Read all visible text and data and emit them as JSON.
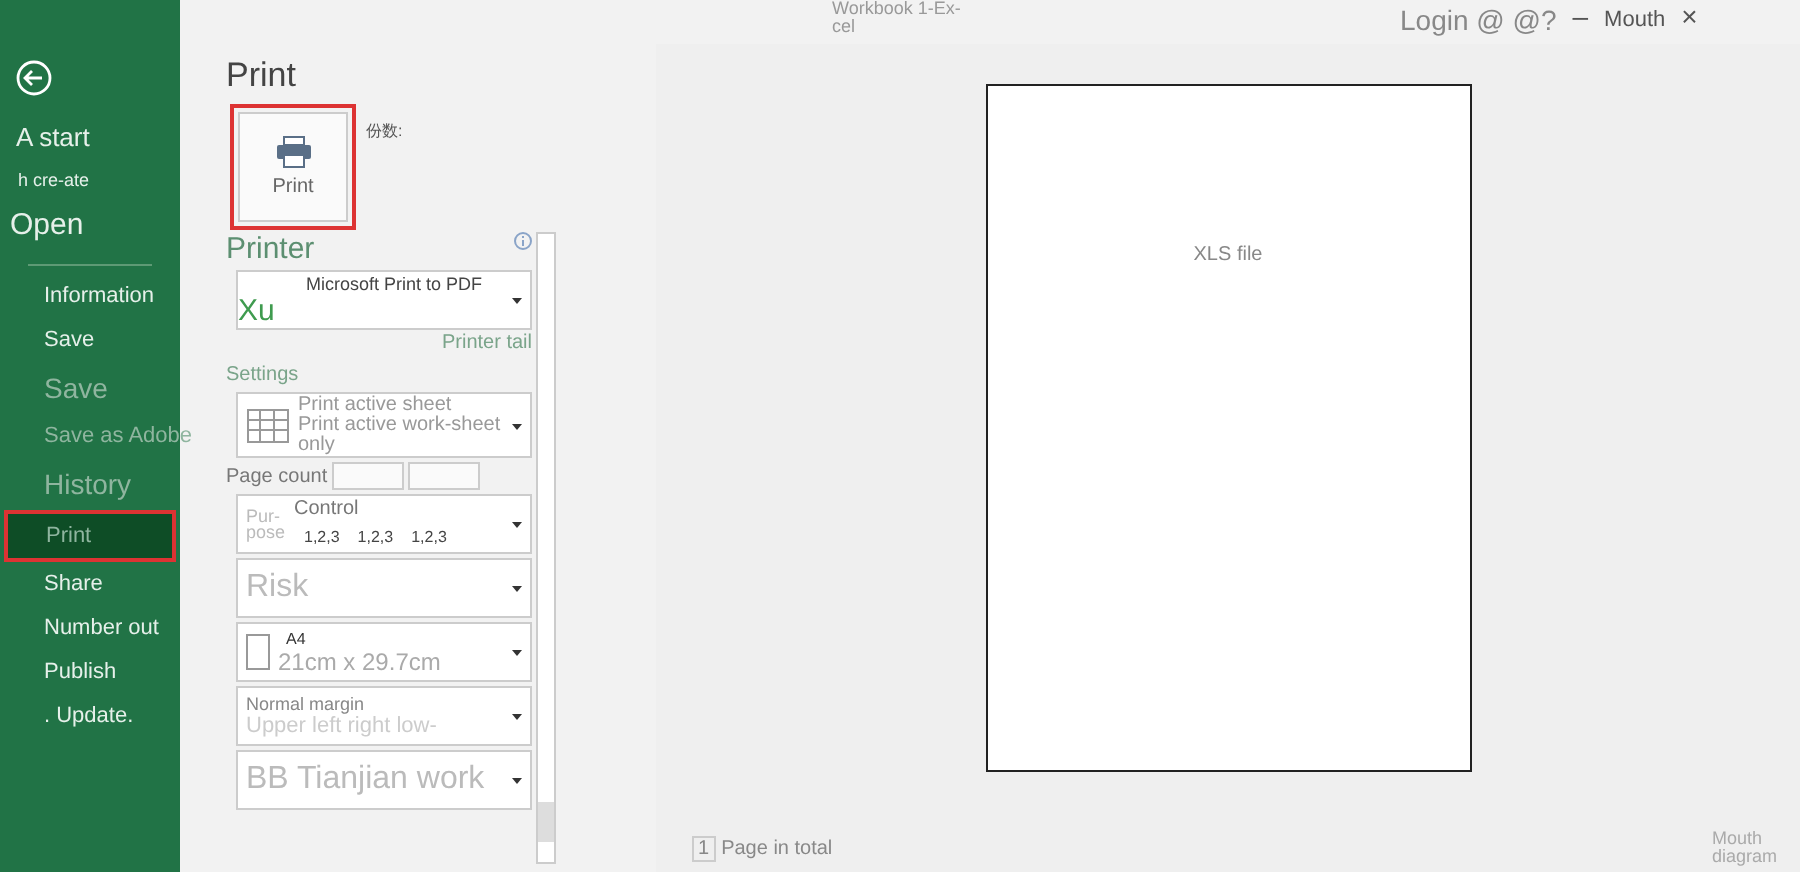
{
  "window": {
    "title": "Workbook 1-Ex-cel",
    "login": "Login @ @?",
    "minimize": "–",
    "account": "Mouth",
    "close": "×"
  },
  "sidebar": {
    "items": [
      {
        "label": "A start",
        "kind": "normal",
        "disabled": false,
        "selected": false
      },
      {
        "label": "h cre-ate",
        "kind": "small",
        "disabled": false,
        "selected": false
      },
      {
        "label": "Open",
        "kind": "large",
        "disabled": false,
        "selected": false
      },
      {
        "label": "Information",
        "kind": "indent",
        "disabled": false,
        "selected": false
      },
      {
        "label": "Save",
        "kind": "indent",
        "disabled": false,
        "selected": false
      },
      {
        "label": "Save",
        "kind": "big",
        "disabled": true,
        "selected": false
      },
      {
        "label": "Save as Adobe",
        "kind": "indent",
        "disabled": true,
        "selected": false
      },
      {
        "label": "History",
        "kind": "big",
        "disabled": true,
        "selected": false
      },
      {
        "label": "Print",
        "kind": "indent",
        "disabled": true,
        "selected": true
      },
      {
        "label": "Share",
        "kind": "indent",
        "disabled": false,
        "selected": false
      },
      {
        "label": "Number out",
        "kind": "indent",
        "disabled": false,
        "selected": false
      },
      {
        "label": "Publish",
        "kind": "indent",
        "disabled": false,
        "selected": false
      },
      {
        "label": ". Update.",
        "kind": "indent",
        "disabled": false,
        "selected": false
      }
    ]
  },
  "print": {
    "heading": "Print",
    "button": "Print",
    "copies_label": "份数:",
    "printer_heading": "Printer",
    "printer": "Microsoft Print to PDF",
    "printer_overlay": "Xu",
    "printer_link": "Printer tail",
    "settings_heading": "Settings",
    "page_count_label": "Page count",
    "dropdowns": [
      {
        "kind": "sheet",
        "lines": [
          "Print active sheet",
          "Print active work-sheet only"
        ]
      },
      {
        "kind": "collate",
        "lines": [
          "Control",
          "1,2,3",
          "1,2,3",
          "1,2,3"
        ],
        "side": "Pur-pose"
      },
      {
        "kind": "plain",
        "lines": [
          "Risk"
        ]
      },
      {
        "kind": "paper",
        "lines": [
          "A4",
          "21cm x 29.7cm"
        ]
      },
      {
        "kind": "margin",
        "lines": [
          "Normal margin",
          "Upper left right low-"
        ]
      },
      {
        "kind": "plain",
        "lines": [
          "BB Tianjian work"
        ]
      }
    ]
  },
  "preview": {
    "page_text": "XLS file",
    "page_count": "1",
    "page_count_suffix": "Page in total",
    "zoom_label": "Mouth diagram"
  }
}
